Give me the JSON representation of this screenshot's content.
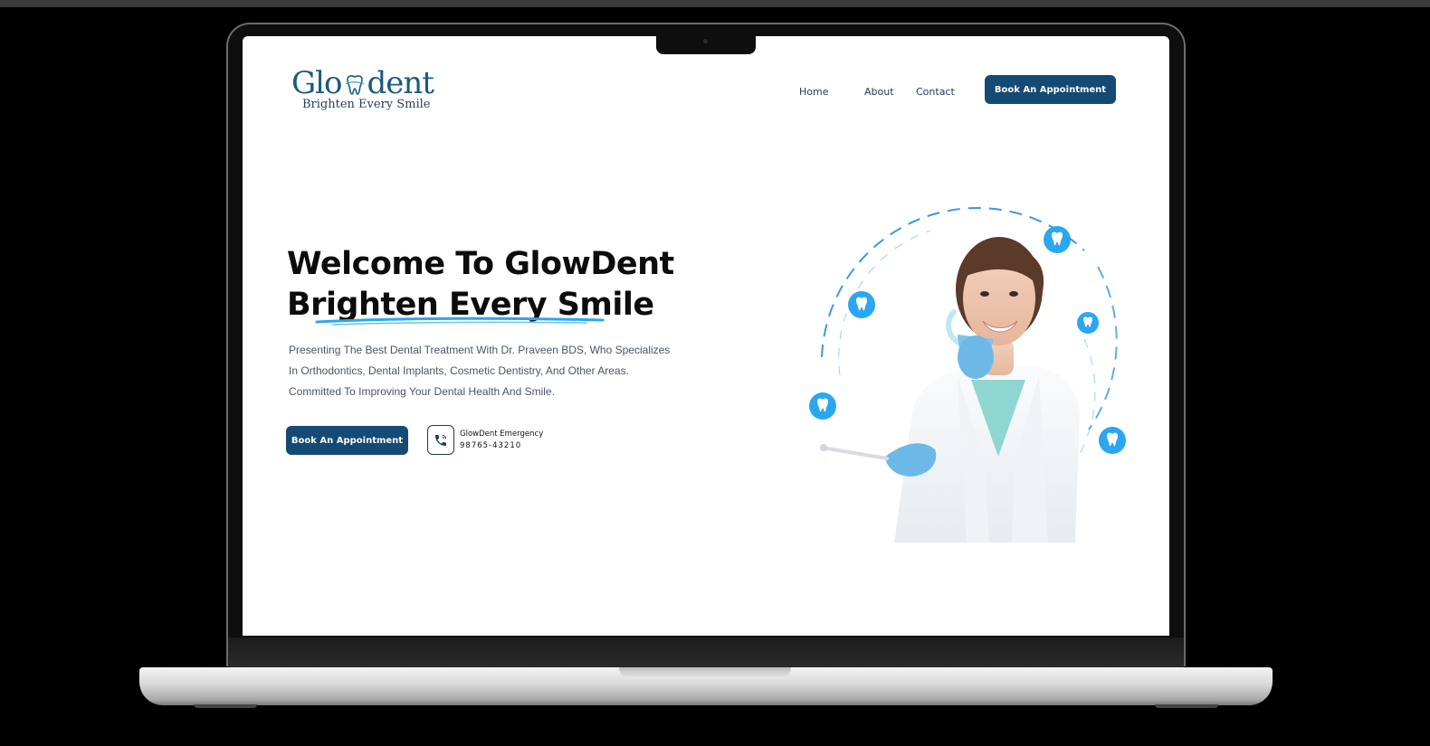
{
  "logo": {
    "wordmark_start": "Glo",
    "wordmark_end": "dent",
    "tagline": "Brighten Every Smile"
  },
  "nav": {
    "items": [
      "Home",
      "About",
      "Contact"
    ],
    "cta": "Book An Appointment"
  },
  "hero": {
    "title_line1": "Welcome To GlowDent",
    "title_line2": "Brighten Every Smile",
    "desc_lines": [
      "Presenting The Best Dental Treatment With Dr. Praveen BDS, Who Specializes",
      "In Orthodontics, Dental Implants, Cosmetic Dentistry, And Other Areas.",
      "Committed To Improving Your Dental Health And Smile."
    ],
    "cta": "Book An Appointment",
    "emergency_label": "GlowDent Emergency",
    "emergency_number": "98765-43210"
  },
  "colors": {
    "brand": "#144a73",
    "accent": "#2aa7f0",
    "logo": "#1a5b7e"
  },
  "icons": [
    "tooth-icon",
    "phone-icon"
  ]
}
